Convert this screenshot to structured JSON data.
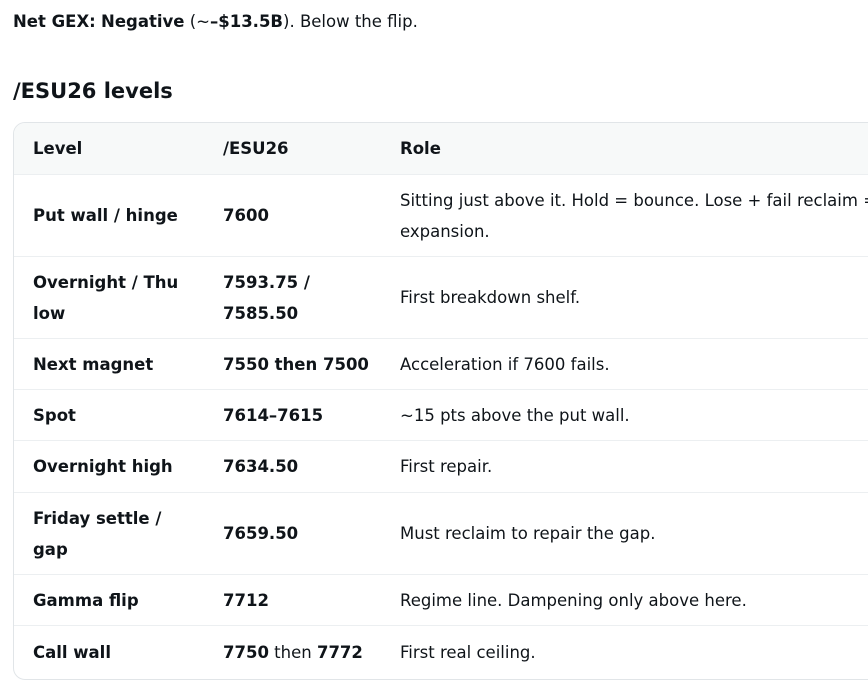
{
  "summary": {
    "label": "Net GEX:",
    "value": "Negative",
    "open_paren": " (~",
    "amount": "–$13.5B",
    "close": "). Below the flip."
  },
  "section": {
    "title": "/ESU26 levels"
  },
  "table": {
    "headers": [
      "Level",
      "/ESU26",
      "Role"
    ],
    "rows": [
      {
        "level": "Put wall / hinge",
        "price": "7600",
        "role": "Sitting just above it. Hold = bounce. Lose + fail reclaim = expansion."
      },
      {
        "level": "Overnight / Thu low",
        "price": "7593.75 / 7585.50",
        "role": "First breakdown shelf."
      },
      {
        "level": "Next magnet",
        "price": "7550 then 7500",
        "role": "Acceleration if 7600 fails."
      },
      {
        "level": "Spot",
        "price": "7614–7615",
        "role": "~15 pts above the put wall."
      },
      {
        "level": "Overnight high",
        "price": "7634.50",
        "role": "First repair."
      },
      {
        "level": "Friday settle / gap",
        "price": "7659.50",
        "role": "Must reclaim to repair the gap."
      },
      {
        "level": "Gamma flip",
        "price": "7712",
        "role": "Regime line. Dampening only above here."
      },
      {
        "level": "Call wall",
        "price_a": "7750",
        "price_mid": " then ",
        "price_b": "7772",
        "role": "First real ceiling."
      }
    ]
  }
}
